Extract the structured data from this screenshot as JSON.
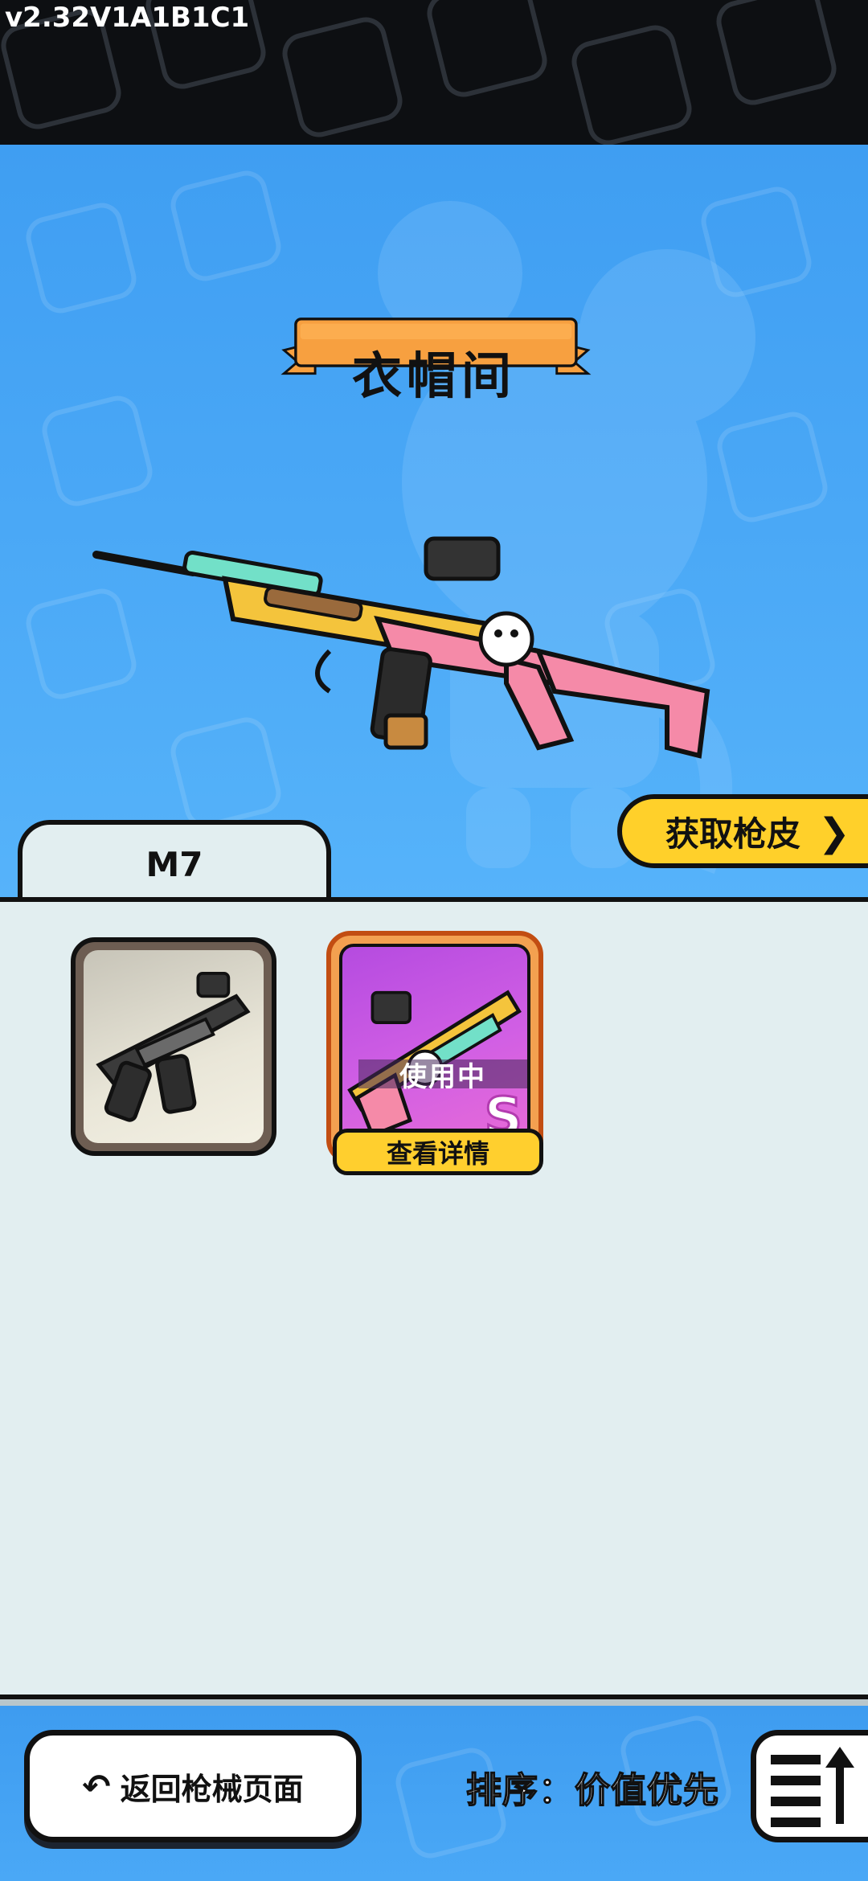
{
  "version": "v2.32V1A1B1C1",
  "title": "衣帽间",
  "get_skin_button": "获取枪皮",
  "weapon_tab": "M7",
  "skins": [
    {
      "in_use": "",
      "grade": ""
    },
    {
      "in_use": "使用中",
      "grade": "S",
      "details": "查看详情"
    }
  ],
  "bottom": {
    "back_label": "返回枪械页面",
    "sort_label": "排序：价值优先"
  },
  "colors": {
    "hero_blue": "#4aa8f6",
    "banner_orange": "#f7a040",
    "accent_yellow": "#ffd02a",
    "panel_bg": "#e2eef0",
    "s_grade_purple": "#c455e2"
  },
  "icons": [
    "back-arrow-icon",
    "chevron-right-icon",
    "sort-icon"
  ]
}
